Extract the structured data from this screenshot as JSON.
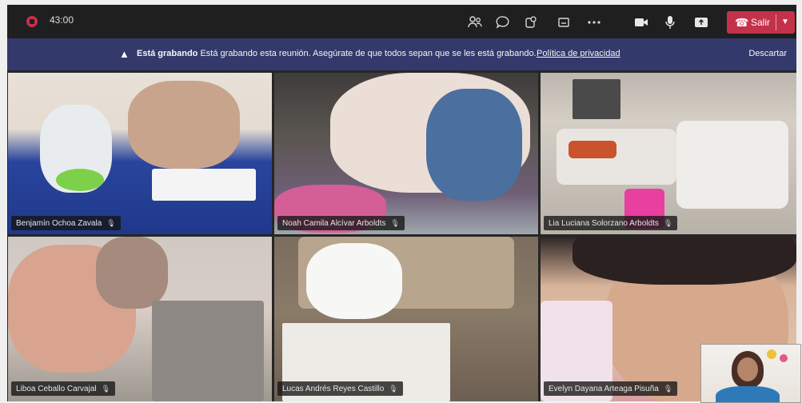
{
  "meeting": {
    "timer": "43:00"
  },
  "toolbar": {
    "icons": [
      "people-icon",
      "chat-icon",
      "reactions-icon",
      "share-tray-icon",
      "more-icon",
      "camera-icon",
      "mic-icon",
      "share-screen-icon"
    ],
    "leave_label": "Salir"
  },
  "banner": {
    "status": "Está grabando",
    "message": "Está grabando esta reunión. Asegúrate de que todos sepan que se les está grabando.",
    "privacy_link": "Política de privacidad",
    "dismiss_label": "Descartar"
  },
  "participants": [
    {
      "name": "Benjamín Ochoa Zavala"
    },
    {
      "name": "Noah Camila Alcívar Arboldts"
    },
    {
      "name": "Lia Luciana Solorzano Arboldts"
    },
    {
      "name": "Liboa Ceballo Carvajal"
    },
    {
      "name": "Lucas Andrés Reyes Castillo"
    },
    {
      "name": "Evelyn Dayana Arteaga Pisuña"
    }
  ],
  "colors": {
    "accent_red": "#c4314b",
    "banner_bg": "#333a6b",
    "topbar_bg": "#1f1f1f"
  }
}
